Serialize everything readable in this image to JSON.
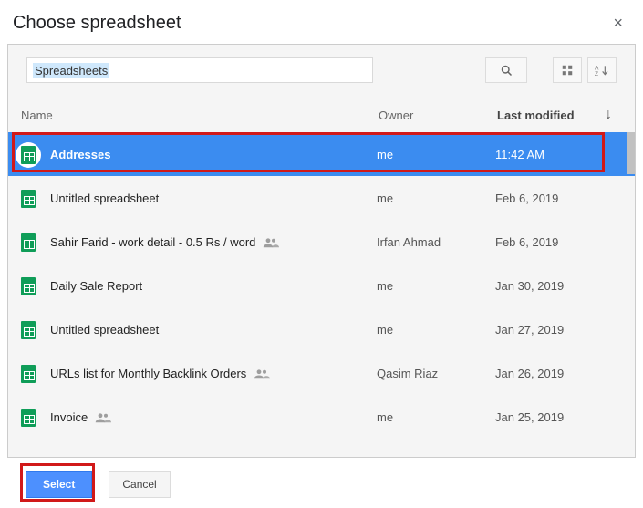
{
  "dialog": {
    "title": "Choose spreadsheet",
    "close_label": "×"
  },
  "search": {
    "value": "Spreadsheets"
  },
  "columns": {
    "name": "Name",
    "owner": "Owner",
    "modified": "Last modified",
    "sort_arrow": "↓"
  },
  "files": [
    {
      "name": "Addresses",
      "owner": "me",
      "modified": "11:42 AM",
      "shared": false,
      "selected": true
    },
    {
      "name": "Untitled spreadsheet",
      "owner": "me",
      "modified": "Feb 6, 2019",
      "shared": false,
      "selected": false
    },
    {
      "name": "Sahir Farid - work detail - 0.5 Rs / word",
      "owner": "Irfan Ahmad",
      "modified": "Feb 6, 2019",
      "shared": true,
      "selected": false
    },
    {
      "name": "Daily Sale Report",
      "owner": "me",
      "modified": "Jan 30, 2019",
      "shared": false,
      "selected": false
    },
    {
      "name": "Untitled spreadsheet",
      "owner": "me",
      "modified": "Jan 27, 2019",
      "shared": false,
      "selected": false
    },
    {
      "name": "URLs list for Monthly Backlink Orders",
      "owner": "Qasim Riaz",
      "modified": "Jan 26, 2019",
      "shared": true,
      "selected": false
    },
    {
      "name": "Invoice",
      "owner": "me",
      "modified": "Jan 25, 2019",
      "shared": true,
      "selected": false
    }
  ],
  "footer": {
    "select": "Select",
    "cancel": "Cancel"
  },
  "icons": {
    "search": "search-icon",
    "grid_view": "grid-view-icon",
    "sort_az": "sort-az-icon",
    "shared": "shared-icon",
    "sheets": "sheets-icon"
  }
}
